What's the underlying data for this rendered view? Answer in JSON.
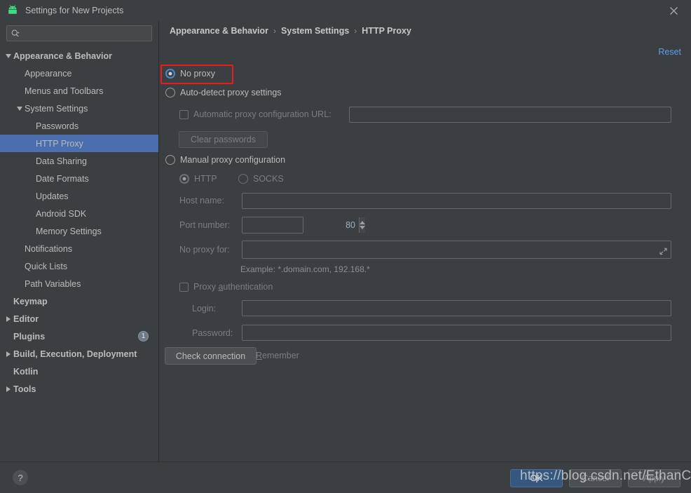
{
  "window": {
    "title": "Settings for New Projects",
    "app_icon": "android-icon",
    "close_icon": "close-icon"
  },
  "sidebar": {
    "search": {
      "placeholder": "",
      "value": "",
      "icon": "search-icon"
    },
    "items": [
      {
        "label": "Appearance & Behavior",
        "indent": 0,
        "twisty": "down",
        "bold": true,
        "selected": false,
        "badge": ""
      },
      {
        "label": "Appearance",
        "indent": 1,
        "twisty": "none",
        "bold": false,
        "selected": false,
        "badge": ""
      },
      {
        "label": "Menus and Toolbars",
        "indent": 1,
        "twisty": "none",
        "bold": false,
        "selected": false,
        "badge": ""
      },
      {
        "label": "System Settings",
        "indent": 1,
        "twisty": "down",
        "bold": false,
        "selected": false,
        "badge": ""
      },
      {
        "label": "Passwords",
        "indent": 2,
        "twisty": "none",
        "bold": false,
        "selected": false,
        "badge": ""
      },
      {
        "label": "HTTP Proxy",
        "indent": 2,
        "twisty": "none",
        "bold": false,
        "selected": true,
        "badge": ""
      },
      {
        "label": "Data Sharing",
        "indent": 2,
        "twisty": "none",
        "bold": false,
        "selected": false,
        "badge": ""
      },
      {
        "label": "Date Formats",
        "indent": 2,
        "twisty": "none",
        "bold": false,
        "selected": false,
        "badge": ""
      },
      {
        "label": "Updates",
        "indent": 2,
        "twisty": "none",
        "bold": false,
        "selected": false,
        "badge": ""
      },
      {
        "label": "Android SDK",
        "indent": 2,
        "twisty": "none",
        "bold": false,
        "selected": false,
        "badge": ""
      },
      {
        "label": "Memory Settings",
        "indent": 2,
        "twisty": "none",
        "bold": false,
        "selected": false,
        "badge": ""
      },
      {
        "label": "Notifications",
        "indent": 1,
        "twisty": "none",
        "bold": false,
        "selected": false,
        "badge": ""
      },
      {
        "label": "Quick Lists",
        "indent": 1,
        "twisty": "none",
        "bold": false,
        "selected": false,
        "badge": ""
      },
      {
        "label": "Path Variables",
        "indent": 1,
        "twisty": "none",
        "bold": false,
        "selected": false,
        "badge": ""
      },
      {
        "label": "Keymap",
        "indent": 0,
        "twisty": "none",
        "bold": true,
        "selected": false,
        "badge": ""
      },
      {
        "label": "Editor",
        "indent": 0,
        "twisty": "right",
        "bold": true,
        "selected": false,
        "badge": ""
      },
      {
        "label": "Plugins",
        "indent": 0,
        "twisty": "none",
        "bold": true,
        "selected": false,
        "badge": "1"
      },
      {
        "label": "Build, Execution, Deployment",
        "indent": 0,
        "twisty": "right",
        "bold": true,
        "selected": false,
        "badge": ""
      },
      {
        "label": "Kotlin",
        "indent": 0,
        "twisty": "none",
        "bold": true,
        "selected": false,
        "badge": ""
      },
      {
        "label": "Tools",
        "indent": 0,
        "twisty": "right",
        "bold": true,
        "selected": false,
        "badge": ""
      }
    ]
  },
  "content": {
    "breadcrumb": [
      "Appearance & Behavior",
      "System Settings",
      "HTTP Proxy"
    ],
    "breadcrumb_separator": "›",
    "reset_label": "Reset",
    "no_proxy": {
      "label": "No proxy",
      "checked": true,
      "highlighted": true
    },
    "auto_detect": {
      "label": "Auto-detect proxy settings",
      "checked": false
    },
    "auto_config_url": {
      "label": "Automatic proxy configuration URL:",
      "checked": false,
      "value": ""
    },
    "clear_passwords_label": "Clear passwords",
    "manual": {
      "label": "Manual proxy configuration",
      "checked": false
    },
    "protocol": {
      "http": {
        "label": "HTTP",
        "checked": true
      },
      "socks": {
        "label": "SOCKS",
        "checked": false
      }
    },
    "host_name": {
      "label": "Host name:",
      "value": ""
    },
    "port_number": {
      "label": "Port number:",
      "value": "80"
    },
    "no_proxy_for": {
      "label": "No proxy for:",
      "value": "",
      "expand_icon": "expand-icon"
    },
    "example_hint": "Example: *.domain.com, 192.168.*",
    "proxy_auth": {
      "label": "Proxy authentication",
      "mnemonic": "a",
      "checked": false
    },
    "login": {
      "label": "Login:",
      "value": ""
    },
    "password": {
      "label": "Password:",
      "value": ""
    },
    "remember": {
      "label": "Remember",
      "mnemonic": "R",
      "checked": false
    },
    "check_connection_label": "Check connection"
  },
  "footer": {
    "help_label": "?",
    "ok_label": "OK",
    "cancel_label": "Cancel",
    "apply_label": "Apply"
  },
  "overlay": {
    "watermark": "https://blog.csdn.net/EthanCo"
  },
  "colors": {
    "background": "#3c3f41",
    "selection": "#4b6eaf",
    "accent_link": "#589df6",
    "primary_button": "#365880",
    "highlight_box": "#ee1b1b",
    "android_green": "#3ddc84"
  }
}
